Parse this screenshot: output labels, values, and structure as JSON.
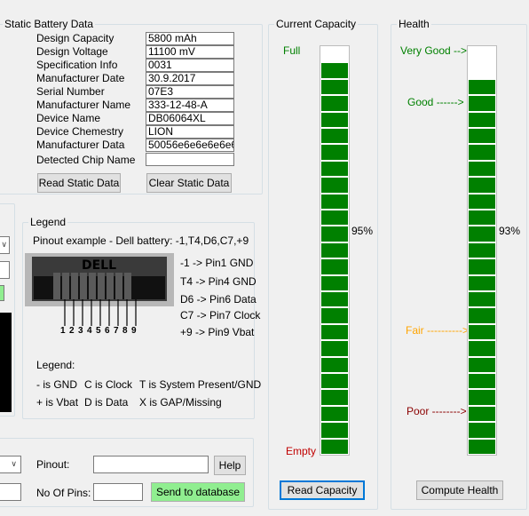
{
  "static_battery": {
    "title": "Static Battery Data",
    "fields": [
      {
        "label": "Design Capacity",
        "value": "5800 mAh"
      },
      {
        "label": "Design Voltage",
        "value": "11100 mV"
      },
      {
        "label": "Specification Info",
        "value": "0031"
      },
      {
        "label": "Manufacturer Date",
        "value": "30.9.2017"
      },
      {
        "label": "Serial Number",
        "value": "07E3"
      },
      {
        "label": "Manufacturer Name",
        "value": "333-12-48-A"
      },
      {
        "label": "Device Name",
        "value": "DB06064XL"
      },
      {
        "label": "Device Chemestry",
        "value": "LION"
      },
      {
        "label": "Manufacturer Data",
        "value": "50056e6e6e6e6e6"
      },
      {
        "label": "Detected Chip Name",
        "value": ""
      }
    ],
    "read_button": "Read Static Data",
    "clear_button": "Clear Static Data"
  },
  "legend": {
    "title": "Legend",
    "pinout_example": "Pinout example - Dell battery:  -1,T4,D6,C7,+9",
    "connector_brand": "DELL",
    "pin_numbers": [
      "1",
      "2",
      "3",
      "4",
      "5",
      "6",
      "7",
      "8",
      "9"
    ],
    "pin_mapping": [
      "-1 -> Pin1 GND",
      "T4 -> Pin4 GND",
      "D6 -> Pin6 Data",
      "C7 -> Pin7 Clock",
      "+9 -> Pin9 Vbat"
    ],
    "legend_label": "Legend:",
    "symbols": [
      {
        "a": "- is GND",
        "b": "C is Clock",
        "c": "T is System Present/GND"
      },
      {
        "a": "+ is Vbat",
        "b": "D is Data",
        "c": "X is GAP/Missing"
      }
    ]
  },
  "bottom_form": {
    "pinout_label": "Pinout:",
    "pinout_value": "",
    "help_button": "Help",
    "pins_label": "No Of Pins:",
    "pins_value": "",
    "send_button": "Send to database"
  },
  "capacity": {
    "title": "Current Capacity",
    "full_label": "Full",
    "empty_label": "Empty",
    "percent_label": "95%",
    "percent": 95,
    "segments": 25,
    "read_button": "Read Capacity",
    "colors": {
      "full": "#008000",
      "empty": "#c00000"
    }
  },
  "health": {
    "title": "Health",
    "very_good": "Very Good -->",
    "good": "Good ------>",
    "fair": "Fair ---------->",
    "poor": "Poor -------->",
    "percent_label": "93%",
    "percent": 93,
    "segments": 25,
    "compute_button": "Compute Health",
    "colors": {
      "very_good": "#008000",
      "good": "#008000",
      "fair": "#ffa500",
      "poor": "#8b0000",
      "bar": "#008000"
    }
  }
}
